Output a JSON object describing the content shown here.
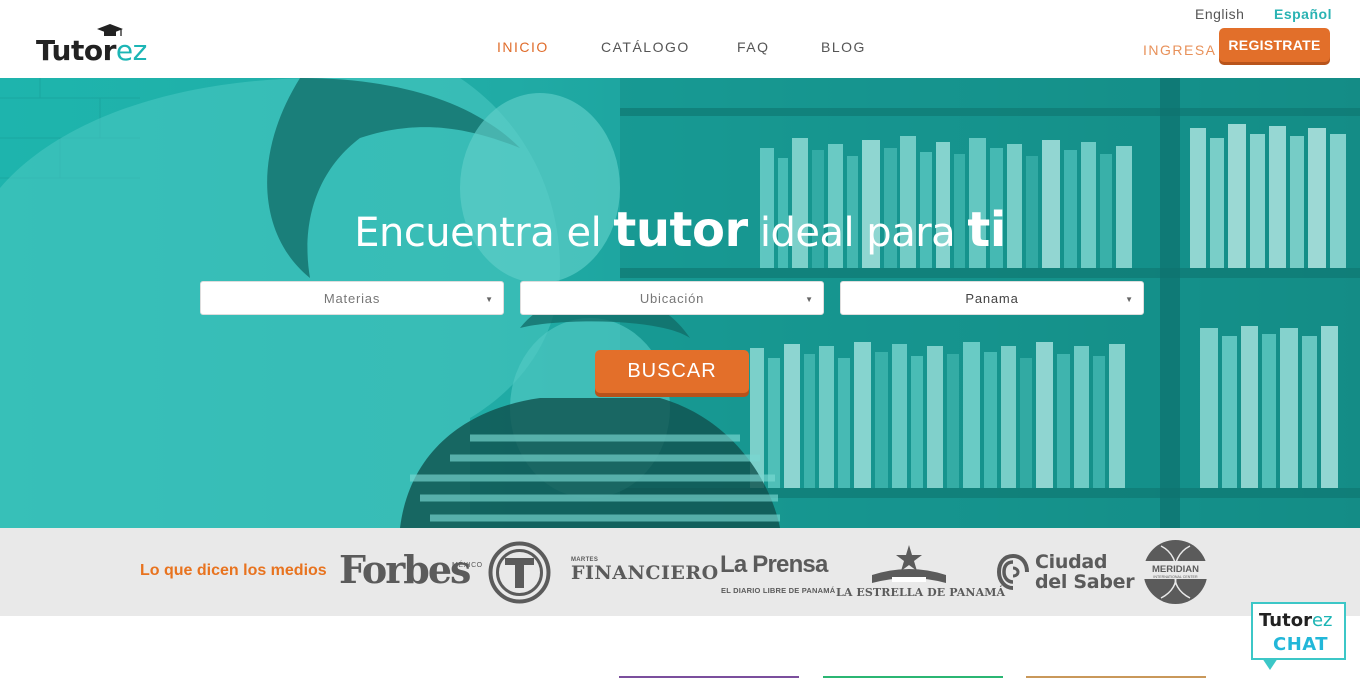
{
  "header": {
    "logo": {
      "main": "Tutor",
      "accent": "ez"
    },
    "nav": [
      {
        "label": "INICIO",
        "active": true
      },
      {
        "label": "CATÁLOGO",
        "active": false
      },
      {
        "label": "FAQ",
        "active": false
      },
      {
        "label": "BLOG",
        "active": false
      }
    ],
    "languages": {
      "english": "English",
      "spanish": "Español"
    },
    "login_label": "INGRESA",
    "register_label": "REGISTRATE"
  },
  "hero": {
    "title_part1": "Encuentra el ",
    "title_bold1": "tutor",
    "title_part2": " ideal para ",
    "title_bold2": "ti",
    "filters": {
      "subjects": "Materias",
      "location": "Ubicación",
      "country": "Panama"
    },
    "search_label": "BUSCAR"
  },
  "media": {
    "label": "Lo que dicen los medios",
    "forbes": "Forbes",
    "forbes_sub": "MÉXICO",
    "financiero_sub": "MARTES",
    "financiero": "FINANCIERO",
    "laprensa": "La Prensa",
    "laprensa_sub": "EL DIARIO LIBRE DE PANAMÁ",
    "estrella": "LA ESTRELLA DE PANAMÁ",
    "ciudad_line1": "Ciudad",
    "ciudad_line2": "del Saber",
    "meridian": "MERIDIAN",
    "meridian_sub": "INTERNATIONAL CENTER"
  },
  "chat": {
    "logo_main": "Tutor",
    "logo_accent": "ez",
    "label": "CHAT"
  },
  "colors": {
    "brand_orange": "#e26f2a",
    "brand_teal": "#1cb5b5",
    "hero_teal": "#1fb8b0"
  }
}
